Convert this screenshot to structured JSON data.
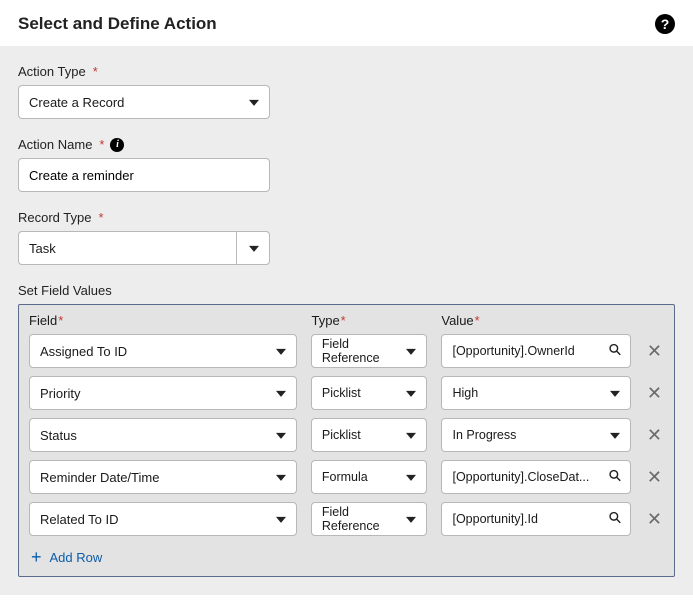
{
  "header": {
    "title": "Select and Define Action"
  },
  "form": {
    "action_type": {
      "label": "Action Type",
      "value": "Create a Record"
    },
    "action_name": {
      "label": "Action Name",
      "value": "Create a reminder"
    },
    "record_type": {
      "label": "Record Type",
      "value": "Task"
    },
    "set_field_values_label": "Set Field Values",
    "columns": {
      "field": "Field",
      "type": "Type",
      "value": "Value"
    },
    "rows": [
      {
        "field": "Assigned To ID",
        "type": "Field Reference",
        "value": "[Opportunity].OwnerId",
        "value_kind": "lookup"
      },
      {
        "field": "Priority",
        "type": "Picklist",
        "value": "High",
        "value_kind": "select"
      },
      {
        "field": "Status",
        "type": "Picklist",
        "value": "In Progress",
        "value_kind": "select"
      },
      {
        "field": "Reminder Date/Time",
        "type": "Formula",
        "value": "[Opportunity].CloseDat...",
        "value_kind": "lookup"
      },
      {
        "field": "Related To ID",
        "type": "Field Reference",
        "value": "[Opportunity].Id",
        "value_kind": "lookup"
      }
    ],
    "add_row_label": "Add Row"
  }
}
